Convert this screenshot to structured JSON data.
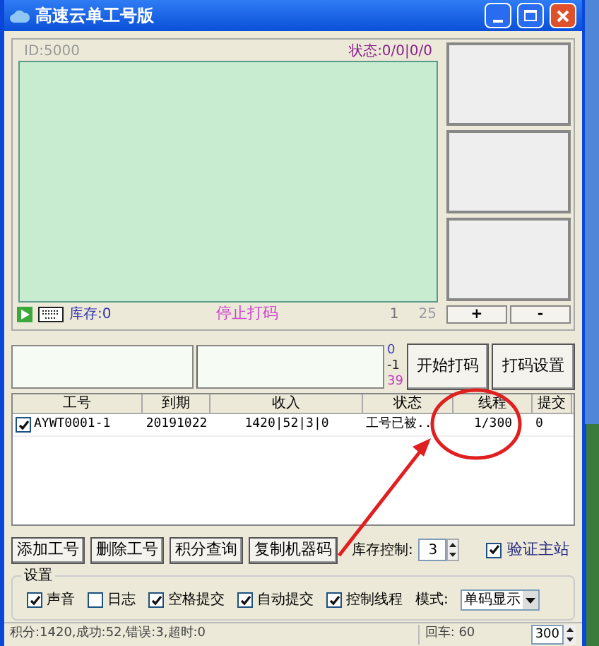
{
  "window": {
    "title": "高速云单工号版"
  },
  "monitor": {
    "id_label": "ID:5000",
    "status": "状态:0/0|0/0",
    "stock": "库存:0",
    "stop_label": "停止打码",
    "page_current": "1",
    "page_total": "25"
  },
  "side_buttons": [
    "+",
    "-"
  ],
  "counters": [
    {
      "text": "0",
      "color": "#3b3bb0"
    },
    {
      "text": "-1",
      "color": "#222222"
    },
    {
      "text": "39",
      "color": "#c040c0"
    }
  ],
  "action_buttons": [
    "开始打码",
    "打码设置"
  ],
  "table": {
    "columns": [
      "工号",
      "到期",
      "收入",
      "状态",
      "线程",
      "提交"
    ],
    "rows": [
      {
        "checked": true,
        "cells": [
          "AYWT0001-1",
          "20191022",
          "1420|52|3|0",
          "工号已被..",
          "1/300",
          "0"
        ]
      }
    ]
  },
  "buttons": [
    "添加工号",
    "删除工号",
    "积分查询",
    "复制机器码"
  ],
  "stock_control": {
    "label": "库存控制:",
    "value": "3"
  },
  "verify": {
    "label": "验证主站",
    "checked": true
  },
  "settings": {
    "title": "设置",
    "options": [
      {
        "label": "声音",
        "checked": true
      },
      {
        "label": "日志",
        "checked": false
      },
      {
        "label": "空格提交",
        "checked": true
      },
      {
        "label": "自动提交",
        "checked": true
      },
      {
        "label": "控制线程",
        "checked": true
      }
    ],
    "mode": {
      "label": "模式:",
      "value": "单码显示"
    }
  },
  "status_bar": {
    "text": "积分:1420,成功:52,错误:3,超时:0",
    "enter": "回车: 60",
    "spinner": "300"
  }
}
